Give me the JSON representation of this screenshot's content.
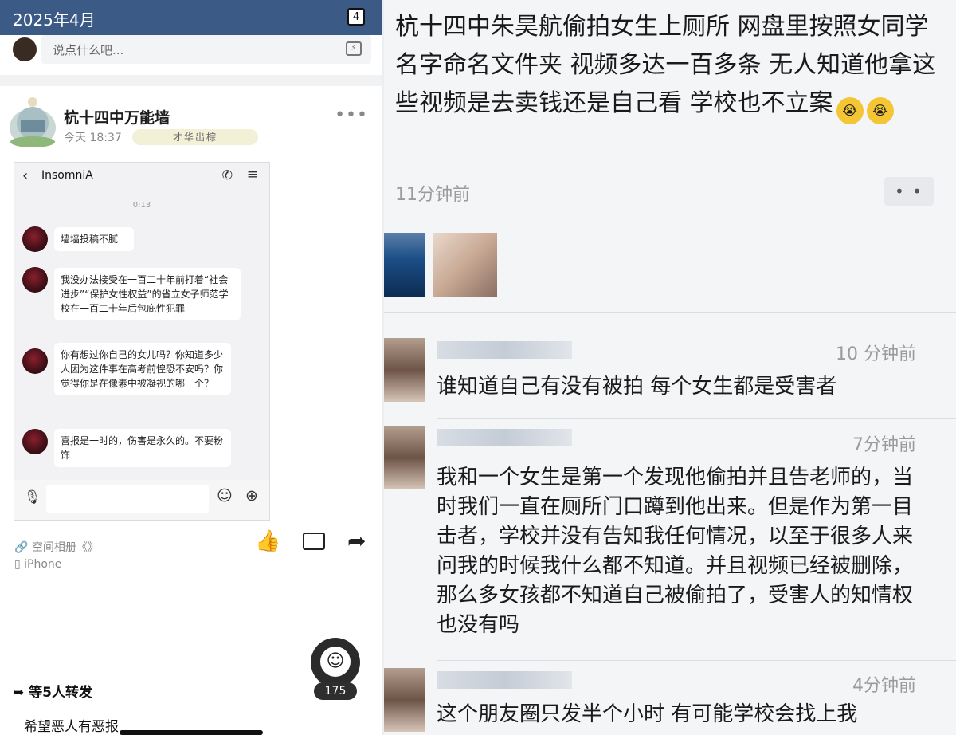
{
  "left": {
    "date": "2025年4月",
    "calendar_day": "4",
    "comment_placeholder": "说点什么吧...",
    "post": {
      "name": "杭十四中万能墙",
      "time": "今天 18:37",
      "badge": "才华出棕"
    },
    "chat": {
      "contact": "InsomniA",
      "timestamp": "0:13",
      "messages": [
        "墙墙投稿不腻",
        "我没办法接受在一百二十年前打着“社会进步”“保护女性权益”的省立女子师范学校在一百二十年后包庇性犯罪",
        "你有想过你自己的女儿吗？你知道多少人因为这件事在高考前惶恐不安吗？你觉得你是在像素中被凝视的哪一个？",
        "喜报是一时的，伤害是永久的。不要粉饰"
      ]
    },
    "album": "空间相册《》",
    "device": "iPhone",
    "float_count": "175",
    "forward": "等5人转发",
    "wish": "希望恶人有恶报"
  },
  "right": {
    "post_text": "杭十四中朱昊航偷拍女生上厕所 网盘里按照女同学名字命名文件夹 视频多达一百多条 无人知道他拿这些视频是去卖钱还是自己看 学校也不立案",
    "time_ago": "11分钟前",
    "comments": [
      {
        "time": "10 分钟前",
        "text": "谁知道自己有没有被拍 每个女生都是受害者"
      },
      {
        "time": "7分钟前",
        "text": "我和一个女生是第一个发现他偷拍并且告老师的，当时我们一直在厕所门口蹲到他出来。但是作为第一目击者，学校并没有告知我任何情况，以至于很多人来问我的时候我什么都不知道。并且视频已经被删除，那么多女孩都不知道自己被偷拍了，受害人的知情权也没有吗"
      },
      {
        "time": "4分钟前",
        "text": "这个朋友圈只发半个小时 有可能学校会找上我"
      }
    ]
  },
  "icons": {
    "calendar": "calendar-icon",
    "voice": "voice-comment-icon",
    "back": "chevron-left-icon",
    "phone": "phone-icon",
    "menu": "menu-icon",
    "mic": "mic-icon",
    "emoji": "emoji-icon",
    "plus": "plus-icon",
    "link": "link-icon",
    "device": "device-icon",
    "like": "thumbs-up-icon",
    "comment": "comment-icon",
    "share": "share-icon",
    "forward": "forward-icon",
    "more": "more-icon"
  }
}
